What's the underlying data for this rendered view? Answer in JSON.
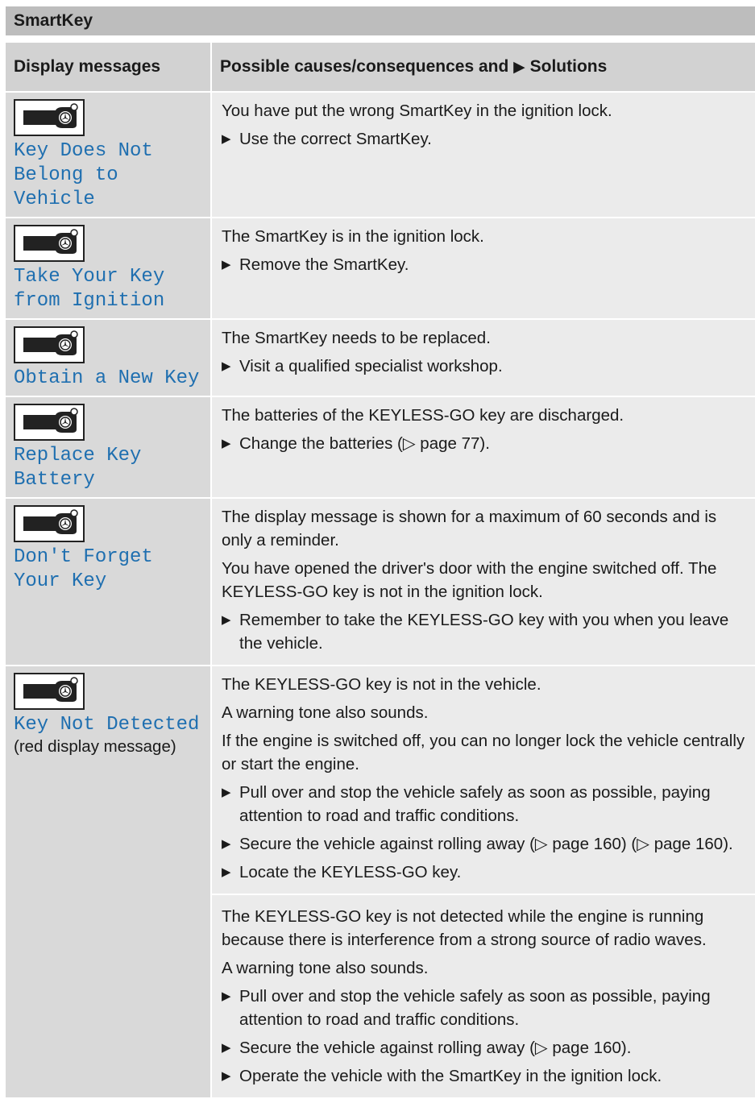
{
  "section_title": "SmartKey",
  "headers": {
    "col1": "Display messages",
    "col2_prefix": "Possible causes/consequences and",
    "col2_suffix": "Solutions"
  },
  "rows": [
    {
      "message": "Key Does Not Belong to Vehicle",
      "causes": [
        "You have put the wrong SmartKey in the ignition lock."
      ],
      "steps": [
        "Use the correct SmartKey."
      ]
    },
    {
      "message": "Take Your Key from Ignition",
      "causes": [
        "The SmartKey is in the ignition lock."
      ],
      "steps": [
        "Remove the SmartKey."
      ]
    },
    {
      "message": "Obtain a New Key",
      "causes": [
        "The SmartKey needs to be replaced."
      ],
      "steps": [
        "Visit a qualified specialist workshop."
      ]
    },
    {
      "message": "Replace Key Battery",
      "causes": [
        "The batteries of the KEYLESS-GO key are discharged."
      ],
      "steps": [
        "Change the batteries (▷ page 77)."
      ]
    },
    {
      "message": "Don't Forget Your Key",
      "causes": [
        "The display message is shown for a maximum of 60 seconds and is only a reminder.",
        "You have opened the driver's door with the engine switched off. The KEYLESS-GO key is not in the ignition lock."
      ],
      "steps": [
        "Remember to take the KEYLESS-GO key with you when you leave the vehicle."
      ]
    },
    {
      "message": "Key Not Detected",
      "note": "(red display message)",
      "causes": [
        "The KEYLESS-GO key is not in the vehicle.",
        "A warning tone also sounds.",
        "If the engine is switched off, you can no longer lock the vehicle centrally or start the engine."
      ],
      "steps": [
        "Pull over and stop the vehicle safely as soon as possible, paying attention to road and traffic conditions.",
        "Secure the vehicle against rolling away (▷ page 160) (▷ page 160).",
        "Locate the KEYLESS-GO key."
      ],
      "causes_b": [
        "The KEYLESS-GO key is not detected while the engine is running because there is interference from a strong source of radio waves.",
        "A warning tone also sounds."
      ],
      "steps_b": [
        "Pull over and stop the vehicle safely as soon as possible, paying attention to road and traffic conditions.",
        "Secure the vehicle against rolling away (▷ page 160).",
        "Operate the vehicle with the SmartKey in the ignition lock."
      ]
    }
  ],
  "icons": {
    "key": "smartkey-icon",
    "step": "arrow-right-icon"
  }
}
